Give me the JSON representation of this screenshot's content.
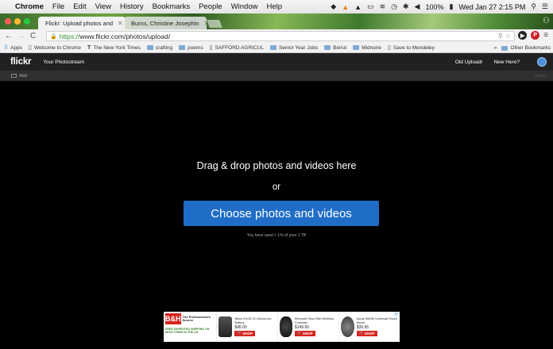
{
  "menubar": {
    "app": "Chrome",
    "items": [
      "File",
      "Edit",
      "View",
      "History",
      "Bookmarks",
      "People",
      "Window",
      "Help"
    ],
    "battery": "100%",
    "datetime": "Wed Jan 27  2:15 PM"
  },
  "tabs": [
    {
      "label": "Flickr: Upload photos and",
      "active": true
    },
    {
      "label": "Burns, Christine Josephin",
      "active": false
    }
  ],
  "address": {
    "scheme": "https://",
    "rest": "www.flickr.com/photos/upload/"
  },
  "bookmarks": {
    "apps": "Apps",
    "items": [
      {
        "label": "Welcome to Chrome",
        "type": "page"
      },
      {
        "label": "The New York Times",
        "type": "nyt"
      },
      {
        "label": "crafting",
        "type": "folder"
      },
      {
        "label": "poems",
        "type": "folder"
      },
      {
        "label": "SAFFORD AGRICUL",
        "type": "page"
      },
      {
        "label": "Senior Year Jobs",
        "type": "folder"
      },
      {
        "label": "Beirut",
        "type": "folder"
      },
      {
        "label": "Midnone",
        "type": "folder"
      },
      {
        "label": "Save to Mendeley",
        "type": "page"
      }
    ],
    "more": "»",
    "other": "Other Bookmarks"
  },
  "flickr": {
    "logo": "flickr",
    "photostream": "Your Photostream",
    "old_uploadr": "Old Uploadr",
    "new_here": "New Here?"
  },
  "toolbar": {
    "add": "Add",
    "upload": "Upload"
  },
  "dropzone": {
    "title": "Drag & drop photos and videos here",
    "or": "or",
    "button": "Choose photos and videos",
    "storage": "You have used < 1% of your 1 TB"
  },
  "ad": {
    "brand_mark": "B&H",
    "brand_tag": "The Professional's Source",
    "shipping": "FREE EXPEDITED SHIPPING ON MOST ITEMS IN THE US",
    "products": [
      {
        "name": "Nikon EN-EL15 Lithium-Ion Battery",
        "price": "$45.00",
        "color": "#3a3a3a"
      },
      {
        "name": "Microsoft Xbox Elite Wireless Controller",
        "price": "$149.95",
        "color": "#1e1e1e"
      },
      {
        "name": "Auray SMSM Universal Shock Mount",
        "price": "$39.95",
        "color": "#555555"
      }
    ],
    "shop": "SHOP",
    "adchoices": "▷"
  },
  "colors": {
    "flickr_blue": "#1f6dc7",
    "bh_red": "#d7261e"
  }
}
